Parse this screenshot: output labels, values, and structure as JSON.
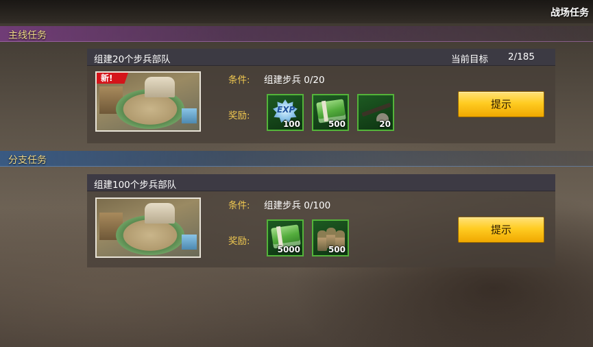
{
  "window": {
    "title": "战场任务"
  },
  "sections": {
    "main": {
      "label": "主线任务"
    },
    "branch": {
      "label": "分支任务"
    }
  },
  "quests": [
    {
      "title": "组建20个步兵部队",
      "goal_label": "当前目标",
      "goal_value": "2/185",
      "is_new": true,
      "new_badge": "新!",
      "condition_label": "条件:",
      "condition_value": "组建步兵 0/20",
      "reward_label": "奖励:",
      "rewards": [
        {
          "icon": "exp-icon",
          "text": "EXP",
          "amount": "100"
        },
        {
          "icon": "cash-icon",
          "amount": "500"
        },
        {
          "icon": "rifle-helmet-icon",
          "amount": "20"
        }
      ],
      "button_label": "提示"
    },
    {
      "title": "组建100个步兵部队",
      "condition_label": "条件:",
      "condition_value": "组建步兵 0/100",
      "reward_label": "奖励:",
      "rewards": [
        {
          "icon": "cash-icon",
          "amount": "5000"
        },
        {
          "icon": "soldiers-icon",
          "amount": "500"
        }
      ],
      "button_label": "提示"
    }
  ],
  "colors": {
    "accent_gold": "#f0c850",
    "button_yellow": "#ffcc22",
    "reward_border_green": "#54b43a",
    "new_badge_red": "#d4141a",
    "main_section_purple": "#783c82",
    "branch_section_blue": "#325a8c"
  }
}
